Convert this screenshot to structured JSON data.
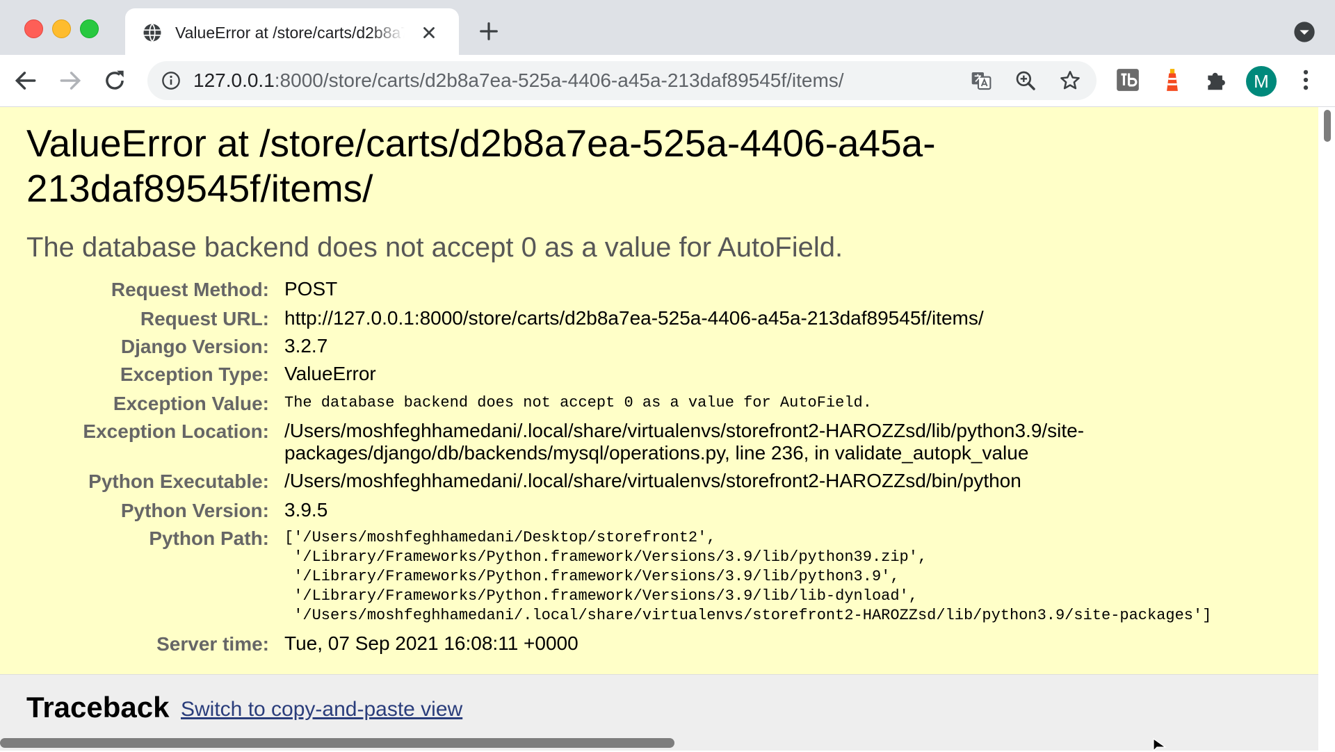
{
  "browser": {
    "tab": {
      "title": "ValueError at /store/carts/d2b8a7ea-525a-4406-a45a-213daf89545f/items/"
    },
    "address_bar": {
      "host": "127.0.0.1",
      "path": ":8000/store/carts/d2b8a7ea-525a-4406-a45a-213daf89545f/items/"
    },
    "profile_initial": "M"
  },
  "page": {
    "title": "ValueError at /store/carts/d2b8a7ea-525a-4406-a45a-213daf89545f/items/",
    "message": "The database backend does not accept 0 as a value for AutoField.",
    "meta": [
      {
        "label": "Request Method:",
        "value": "POST"
      },
      {
        "label": "Request URL:",
        "value": "http://127.0.0.1:8000/store/carts/d2b8a7ea-525a-4406-a45a-213daf89545f/items/"
      },
      {
        "label": "Django Version:",
        "value": "3.2.7"
      },
      {
        "label": "Exception Type:",
        "value": "ValueError"
      },
      {
        "label": "Exception Value:",
        "value": "The database backend does not accept 0 as a value for AutoField."
      },
      {
        "label": "Exception Location:",
        "value": "/Users/moshfeghhamedani/.local/share/virtualenvs/storefront2-HAROZZsd/lib/python3.9/site-packages/django/db/backends/mysql/operations.py, line 236, in validate_autopk_value"
      },
      {
        "label": "Python Executable:",
        "value": "/Users/moshfeghhamedani/.local/share/virtualenvs/storefront2-HAROZZsd/bin/python"
      },
      {
        "label": "Python Version:",
        "value": "3.9.5"
      },
      {
        "label": "Python Path:",
        "value": "['/Users/moshfeghhamedani/Desktop/storefront2',\n '/Library/Frameworks/Python.framework/Versions/3.9/lib/python39.zip',\n '/Library/Frameworks/Python.framework/Versions/3.9/lib/python3.9',\n '/Library/Frameworks/Python.framework/Versions/3.9/lib/lib-dynload',\n '/Users/moshfeghhamedani/.local/share/virtualenvs/storefront2-HAROZZsd/lib/python3.9/site-packages']"
      },
      {
        "label": "Server time:",
        "value": "Tue, 07 Sep 2021 16:08:11 +0000"
      }
    ],
    "traceback": {
      "heading": "Traceback",
      "switch_link": "Switch to copy-and-paste view"
    }
  },
  "icons": {
    "tab_favicon": "globe-icon",
    "tab_close": "close-icon",
    "new_tab": "plus-icon",
    "tab_search": "chevron-down-circle-icon",
    "back": "arrow-left-icon",
    "forward": "arrow-right-icon",
    "reload": "reload-icon",
    "site_info": "info-icon",
    "translate": "translate-icon",
    "zoom": "zoom-in-icon",
    "bookmark": "star-icon",
    "extensions": [
      "tb-extension-icon",
      "lighthouse-icon",
      "puzzle-icon"
    ],
    "menu": "kebab-menu-icon"
  }
}
